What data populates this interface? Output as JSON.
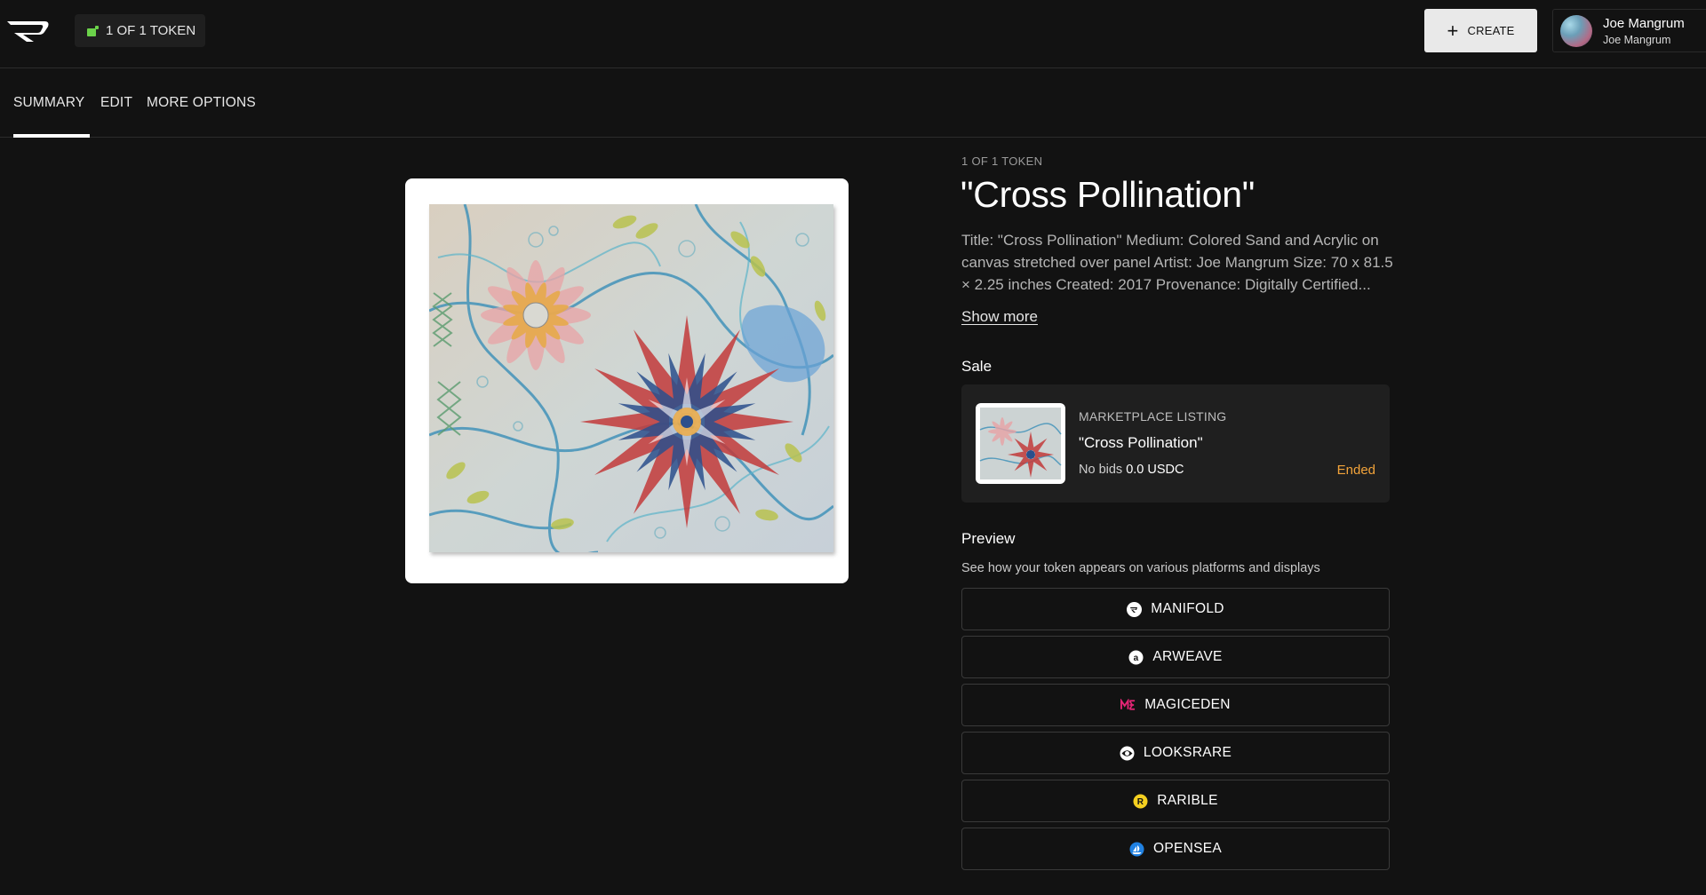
{
  "topbar": {
    "token_chip": "1 OF 1 TOKEN",
    "create_label": "CREATE",
    "user": {
      "name": "Joe Mangrum",
      "handle": "Joe Mangrum"
    }
  },
  "tabs": [
    {
      "label": "SUMMARY",
      "active": true
    },
    {
      "label": "EDIT",
      "active": false
    },
    {
      "label": "MORE OPTIONS",
      "active": false
    }
  ],
  "token": {
    "eyebrow": "1 OF 1 TOKEN",
    "title": "\"Cross Pollination\"",
    "description": "Title: \"Cross Pollination\" Medium: Colored Sand and Acrylic on canvas stretched over panel Artist: Joe Mangrum Size: 70 x 81.5 × 2.25 inches Created: 2017 Provenance: Digitally Certified...",
    "show_more": "Show more"
  },
  "sale": {
    "heading": "Sale",
    "listing_type": "MARKETPLACE LISTING",
    "listing_title": "\"Cross Pollination\"",
    "bids_label": "No bids",
    "price": "0.0 USDC",
    "status": "Ended"
  },
  "preview": {
    "heading": "Preview",
    "description": "See how your token appears on various platforms and displays",
    "platforms": [
      {
        "label": "MANIFOLD",
        "icon": "manifold-icon"
      },
      {
        "label": "ARWEAVE",
        "icon": "arweave-icon"
      },
      {
        "label": "MAGICEDEN",
        "icon": "magiceden-icon"
      },
      {
        "label": "LOOKSRARE",
        "icon": "looksrare-icon"
      },
      {
        "label": "RARIBLE",
        "icon": "rarible-icon"
      },
      {
        "label": "OPENSEA",
        "icon": "opensea-icon"
      }
    ]
  },
  "colors": {
    "background": "#121212",
    "card": "#1f1f1f",
    "status_ended": "#f2a33a",
    "chip_green": "#6bd24a"
  }
}
